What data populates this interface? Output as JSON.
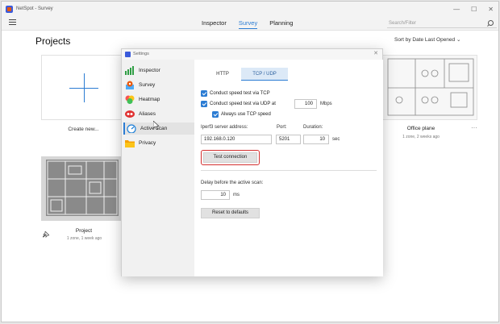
{
  "window": {
    "title": "NetSpot - Survey",
    "controls": [
      "—",
      "☐",
      "✕"
    ]
  },
  "appbar": {
    "tabs": [
      {
        "label": "Inspector",
        "active": false
      },
      {
        "label": "Survey",
        "active": true
      },
      {
        "label": "Planning",
        "active": false
      }
    ],
    "search_placeholder": "Search/Filter"
  },
  "main": {
    "title": "Projects",
    "sort_label": "Sort by Date Last Opened ⌄",
    "create_label": "Create new...",
    "projects": [
      {
        "title": "Office plane",
        "subtitle": "1 zone, 2 weeks ago",
        "menu": "···"
      },
      {
        "title": "Project",
        "subtitle": "1 zone, 1 week ago",
        "menu": "···"
      }
    ]
  },
  "settings": {
    "title": "Settings",
    "close": "✕",
    "sidebar": [
      {
        "label": "Inspector",
        "icon": "bar-chart-icon",
        "color": "#2f9e44",
        "active": false
      },
      {
        "label": "Survey",
        "icon": "survey-pin-icon",
        "color": "#e8590c",
        "active": false
      },
      {
        "label": "Heatmap",
        "icon": "heatmap-icon",
        "color": "#f08c00",
        "active": false
      },
      {
        "label": "Aliases",
        "icon": "aliases-icon",
        "color": "#e03131",
        "active": false
      },
      {
        "label": "Active scan",
        "icon": "speedometer-icon",
        "color": "#1c7ed6",
        "active": true
      },
      {
        "label": "Privacy",
        "icon": "folder-icon",
        "color": "#f59f00",
        "active": false
      }
    ],
    "tabs": {
      "http": "HTTP",
      "tcp_udp": "TCP / UDP"
    },
    "tcp_check": "Conduct speed test via TCP",
    "udp_check": "Conduct speed test via UDP at",
    "udp_value": "100",
    "udp_unit": "Mbps",
    "always_tcp": "Always use TCP speed",
    "server_label": "Iperf3 server address:",
    "server_value": "192.168.0.120",
    "port_label": "Port:",
    "port_value": "5201",
    "duration_label": "Duration:",
    "duration_value": "10",
    "duration_unit": "sec",
    "test_button": "Test connection",
    "delay_label": "Delay before the active scan:",
    "delay_value": "10",
    "delay_unit": "ms",
    "reset_button": "Reset to defaults",
    "accent_color": "#2b7cd3",
    "highlight_color": "#d32f2f"
  }
}
